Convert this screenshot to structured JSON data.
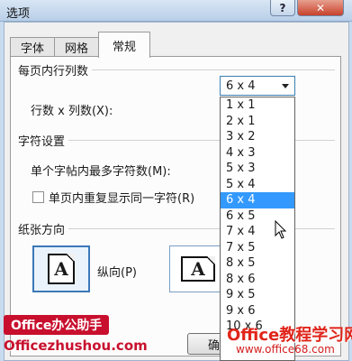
{
  "window": {
    "title": "选项",
    "help_label": "?",
    "close_label": "✕"
  },
  "tabs": [
    {
      "label": "字体"
    },
    {
      "label": "网格"
    },
    {
      "label": "常规",
      "selected": true
    }
  ],
  "section_rows_cols": {
    "heading": "每页内行列数",
    "label": "行数 x 列数(X):",
    "combo_value": "6 x 4"
  },
  "dropdown": {
    "options": [
      "1 x 1",
      "2 x 1",
      "3 x 2",
      "4 x 3",
      "5 x 3",
      "5 x 4",
      "6 x 4",
      "6 x 5",
      "7 x 4",
      "7 x 5",
      "8 x 5",
      "8 x 6",
      "9 x 5",
      "9 x 6",
      "10 x 6"
    ],
    "selected": "6 x 4"
  },
  "section_chars": {
    "heading": "字符设置",
    "max_chars_label": "单个字帖内最多字符数(M):",
    "repeat_label": "单页内重复显示同一字符(R)",
    "repeat_checked": false
  },
  "section_orientation": {
    "heading": "纸张方向",
    "portrait_label": "纵向(P)",
    "portrait_glyph": "A",
    "landscape_glyph": "A",
    "selected": "portrait"
  },
  "buttons": {
    "ok_label": "确定"
  },
  "watermarks": {
    "badge": "Office办公助手",
    "url": "Officezhushou.com",
    "right_title": "Office教程学习网",
    "right_url": "www.office68.com"
  },
  "colors": {
    "selection": "#3399ff",
    "accent_border": "#3c7fb1",
    "watermark_red": "#c8102e"
  }
}
